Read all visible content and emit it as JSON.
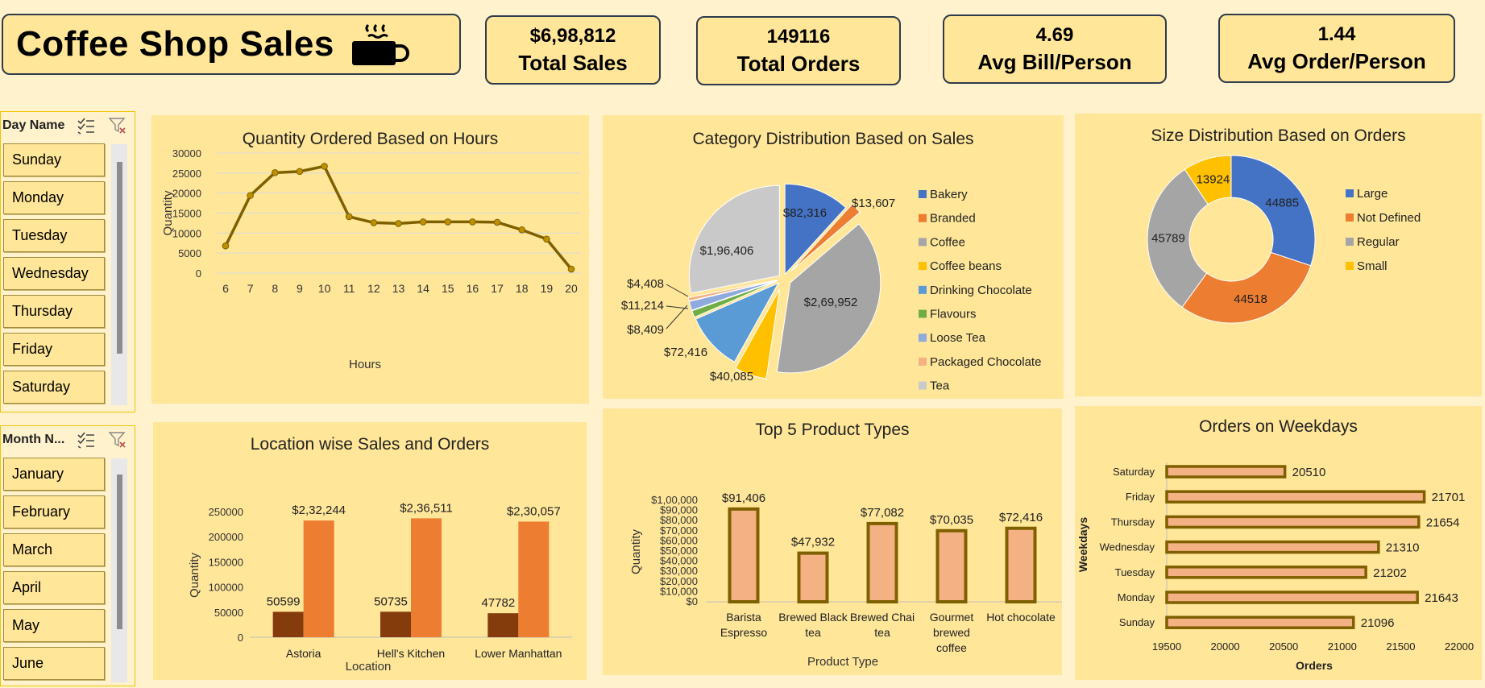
{
  "header": {
    "title": "Coffee Shop Sales",
    "kpis": [
      {
        "value": "$6,98,812",
        "label": "Total Sales"
      },
      {
        "value": "149116",
        "label": "Total Orders"
      },
      {
        "value": "4.69",
        "label": "Avg Bill/Person"
      },
      {
        "value": "1.44",
        "label": "Avg Order/Person"
      }
    ]
  },
  "day_slicer": {
    "title": "Day Name",
    "items": [
      "Sunday",
      "Monday",
      "Tuesday",
      "Wednesday",
      "Thursday",
      "Friday",
      "Saturday"
    ]
  },
  "month_slicer": {
    "title": "Month N...",
    "items": [
      "January",
      "February",
      "March",
      "April",
      "May",
      "June"
    ]
  },
  "chart_data": [
    {
      "type": "line",
      "title": "Quantity Ordered Based on Hours",
      "xlabel": "Hours",
      "ylabel": "Quantity",
      "x": [
        6,
        7,
        8,
        9,
        10,
        11,
        12,
        13,
        14,
        15,
        16,
        17,
        18,
        19,
        20
      ],
      "values": [
        6800,
        19400,
        25100,
        25400,
        26700,
        14100,
        12600,
        12400,
        12800,
        12800,
        12800,
        12700,
        10800,
        8500,
        1000
      ],
      "ylim": [
        0,
        30000
      ],
      "yticks": [
        "0",
        "5000",
        "10000",
        "15000",
        "20000",
        "25000",
        "30000"
      ],
      "grid": true,
      "color": "#7f6000"
    },
    {
      "type": "pie",
      "title": "Category Distribution Based on Sales",
      "categories": [
        "Bakery",
        "Branded",
        "Coffee",
        "Coffee beans",
        "Drinking Chocolate",
        "Flavours",
        "Loose Tea",
        "Packaged Chocolate",
        "Tea"
      ],
      "values": [
        82316,
        13607,
        269952,
        40085,
        72416,
        8409,
        11214,
        4408,
        196406
      ],
      "labels": [
        "$82,316",
        "$13,607",
        "$2,69,952",
        "$40,085",
        "$72,416",
        "$8,409",
        "$11,214",
        "$4,408",
        "$1,96,406"
      ],
      "colors": [
        "#4472c4",
        "#ed7d31",
        "#a5a5a5",
        "#ffc000",
        "#5b9bd5",
        "#70ad47",
        "#8faadc",
        "#f4b183",
        "#c9c9c9"
      ],
      "legend": "right"
    },
    {
      "type": "pie",
      "subtype": "doughnut",
      "title": "Size Distribution Based on Orders",
      "categories": [
        "Large",
        "Not Defined",
        "Regular",
        "Small"
      ],
      "values": [
        44885,
        44518,
        45789,
        13924
      ],
      "labels": [
        "44885",
        "44518",
        "45789",
        "13924"
      ],
      "colors": [
        "#4472c4",
        "#ed7d31",
        "#a5a5a5",
        "#ffc000"
      ],
      "legend": "right"
    },
    {
      "type": "bar",
      "title": "Location wise Sales and Orders",
      "xlabel": "Location",
      "ylabel": "Quantity",
      "categories": [
        "Astoria",
        "Hell's Kitchen",
        "Lower Manhattan"
      ],
      "series": [
        {
          "values": [
            50599,
            50735,
            47782
          ],
          "labels": [
            "50599",
            "50735",
            "47782"
          ],
          "color": "#843c0c"
        },
        {
          "values": [
            232244,
            236511,
            230057
          ],
          "labels": [
            "$2,32,244",
            "$2,36,511",
            "$2,30,057"
          ],
          "color": "#ed7d31"
        }
      ],
      "ylim": [
        0,
        250000
      ],
      "yticks": [
        "0",
        "50000",
        "100000",
        "150000",
        "200000",
        "250000"
      ]
    },
    {
      "type": "bar",
      "title": "Top 5 Product Types",
      "xlabel": "Product Type",
      "ylabel": "Quantity",
      "categories": [
        [
          "Barista",
          "Espresso"
        ],
        [
          "Brewed Black",
          "tea"
        ],
        [
          "Brewed Chai",
          "tea"
        ],
        [
          "Gourmet",
          "brewed",
          "coffee"
        ],
        [
          "Hot chocolate"
        ]
      ],
      "values": [
        91406,
        47932,
        77082,
        70035,
        72416
      ],
      "labels": [
        "$91,406",
        "$47,932",
        "$77,082",
        "$70,035",
        "$72,416"
      ],
      "ylim": [
        0,
        100000
      ],
      "yticks": [
        "$0",
        "$10,000",
        "$20,000",
        "$30,000",
        "$40,000",
        "$50,000",
        "$60,000",
        "$70,000",
        "$80,000",
        "$90,000",
        "$1,00,000"
      ],
      "fill": "#f4b183",
      "stroke": "#7f6000"
    },
    {
      "type": "bar",
      "orientation": "horizontal",
      "title": "Orders on Weekdays",
      "xlabel": "Orders",
      "ylabel": "Weekdays",
      "categories": [
        "Saturday",
        "Friday",
        "Thursday",
        "Wednesday",
        "Tuesday",
        "Monday",
        "Sunday"
      ],
      "values": [
        20510,
        21701,
        21654,
        21310,
        21202,
        21643,
        21096
      ],
      "labels": [
        "20510",
        "21701",
        "21654",
        "21310",
        "21202",
        "21643",
        "21096"
      ],
      "xlim": [
        19500,
        22000
      ],
      "xticks": [
        "19500",
        "20000",
        "20500",
        "21000",
        "21500",
        "22000"
      ],
      "fill": "#f4b183",
      "stroke": "#7f6000"
    }
  ]
}
